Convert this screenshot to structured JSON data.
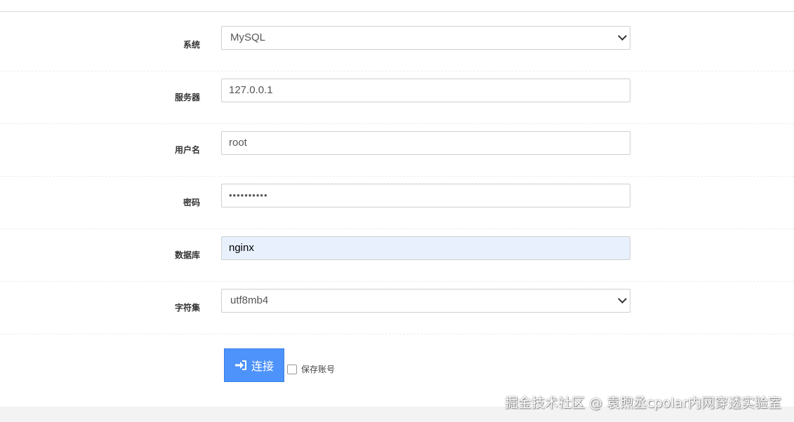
{
  "form": {
    "system": {
      "label": "系统",
      "value": "MySQL"
    },
    "server": {
      "label": "服务器",
      "value": "127.0.0.1"
    },
    "username": {
      "label": "用户名",
      "value": "root"
    },
    "password": {
      "label": "密码",
      "value": "••••••••••"
    },
    "database": {
      "label": "数据库",
      "value": "nginx"
    },
    "charset": {
      "label": "字符集",
      "value": "utf8mb4"
    }
  },
  "actions": {
    "connect_label": "连接",
    "remember_label": "保存账号",
    "remember_checked": false
  },
  "colors": {
    "primary_button": "#4d93fb",
    "autofill_bg": "#e8f0fe"
  },
  "watermark": "掘金技术社区 @ 袁煦丞cpolar内网穿透实验室"
}
